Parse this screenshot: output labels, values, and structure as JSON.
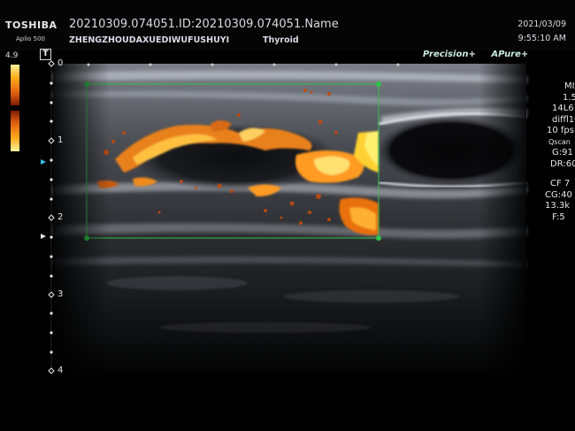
{
  "header": {
    "brand": "TOSHIBA",
    "model": "Aplio 500",
    "study_id": "20210309.074051.ID:20210309.074051.Name",
    "institution": "ZHENGZHOUDAXUEDIWUFUSHUYI",
    "preset": "Thyroid",
    "date": "2021/03/09",
    "time": "9:55:10 AM"
  },
  "color_scale": {
    "value": "4.9",
    "colors": [
      "#fff3a0",
      "#ffb020",
      "#e06010",
      "#7a1a05"
    ]
  },
  "orientation_marker": "T",
  "depth_scale": [
    "0",
    "1",
    "2",
    "3",
    "4"
  ],
  "image_settings": {
    "precision_label": "Precision",
    "precision_symbol": "+",
    "apure_label": "Pure",
    "apure_prefix": "A",
    "apure_symbol": "+",
    "lines": [
      "MI",
      "1.5",
      "14L6",
      "diffl10",
      "10 fps",
      "Qscan",
      "G:91",
      "DR:60",
      "CF 7",
      "CG:40",
      "13.3k",
      "F:5"
    ]
  },
  "roi_box_color": "#2fc24a"
}
